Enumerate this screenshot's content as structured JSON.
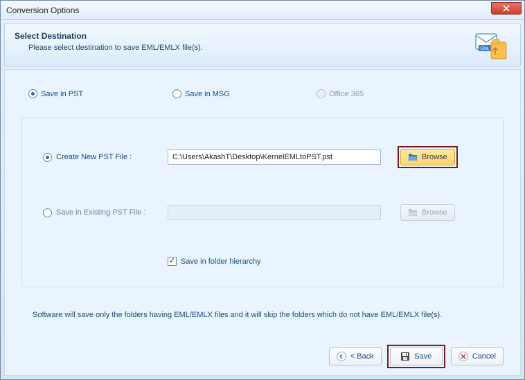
{
  "window": {
    "title": "Conversion Options"
  },
  "header": {
    "title": "Select Destination",
    "desc": "Please select destination to save EML/EMLX file(s)."
  },
  "radios": {
    "save_pst": "Save in PST",
    "save_msg": "Save in MSG",
    "office365": "Office 365"
  },
  "rows": {
    "create_new": "Create New PST File :",
    "existing": "Save in Existing PST File :",
    "path_value": "C:\\Users\\AkashT\\Desktop\\KernelEMLtoPST.pst",
    "browse": "Browse",
    "folder_hierarchy": "Save in folder hierarchy"
  },
  "note": "Software will save only the folders having EML/EMLX files and it will skip the folders which do not have EML/EMLX file(s).",
  "buttons": {
    "back": "< Back",
    "save": "Save",
    "cancel": "Cancel"
  }
}
